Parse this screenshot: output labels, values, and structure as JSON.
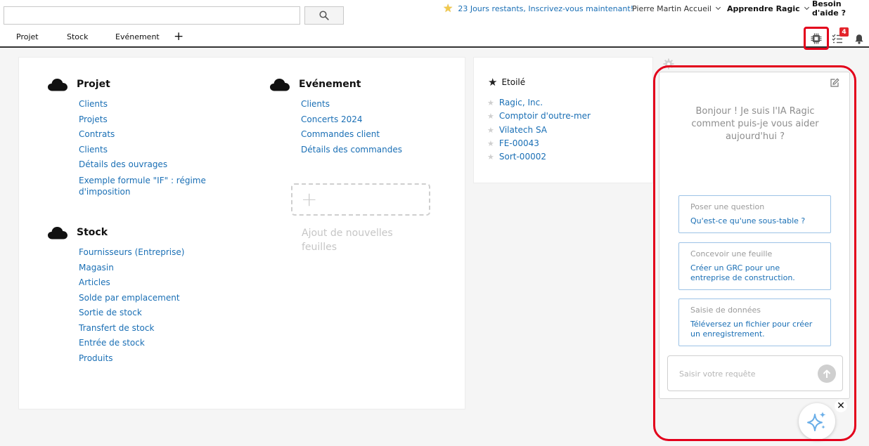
{
  "search": {
    "placeholder": "",
    "value": ""
  },
  "header": {
    "trial_text": "23 Jours restants, Inscrivez-vous maintenant!",
    "user_menu": "Pierre Martin Accueil",
    "learn_menu": "Apprendre Ragic",
    "help_menu": "Besoin d'aide ?"
  },
  "tabs": [
    {
      "label": "Projet"
    },
    {
      "label": "Stock"
    },
    {
      "label": "Evénement"
    }
  ],
  "tab_add_label": "+",
  "icons": {
    "ai_assistant": "chip-icon",
    "tasks": "tasks-icon",
    "notifications": "bell-icon"
  },
  "task_badge": "4",
  "colors": {
    "accent": "#1a6fb5",
    "highlight": "#e3001b",
    "badge": "#e3242b"
  },
  "groups": [
    {
      "title": "Projet",
      "links": [
        "Clients",
        "Projets",
        "Contrats",
        "Clients",
        "Détails des ouvrages",
        "Exemple formule \"IF\" : régime d'imposition"
      ]
    },
    {
      "title": "Evénement",
      "links": [
        "Clients",
        "Concerts 2024",
        "Commandes client",
        "Détails des commandes"
      ]
    },
    {
      "title": "Stock",
      "links": [
        "Fournisseurs (Entreprise)",
        "Magasin",
        "Articles",
        "Solde par emplacement",
        "Sortie de stock",
        "Transfert de stock",
        "Entrée de stock",
        "Produits"
      ]
    }
  ],
  "add_sheet": {
    "icon": "+",
    "label": "Ajout de nouvelles feuilles"
  },
  "starred": {
    "title": "Etoilé",
    "items": [
      "Ragic, Inc.",
      "Comptoir d'outre-mer",
      "Vilatech SA",
      "FE-00043",
      "Sort-00002"
    ]
  },
  "ai": {
    "greeting": "Bonjour ! Je suis l'IA Ragic comment puis-je vous aider aujourd'hui ?",
    "suggestions": [
      {
        "category": "Poser une question",
        "question": "Qu'est-ce qu'une sous-table ?"
      },
      {
        "category": "Concevoir une feuille",
        "question": "Créer un GRC pour une entreprise de construction."
      },
      {
        "category": "Saisie de données",
        "question": "Téléversez un fichier pour créer un enregistrement."
      }
    ],
    "input_placeholder": "Saisir votre requête",
    "close_label": "✕"
  }
}
